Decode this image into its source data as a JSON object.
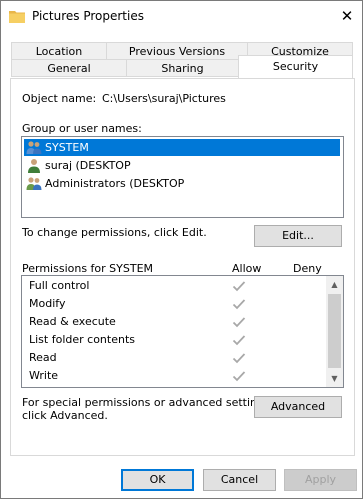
{
  "window": {
    "title": "Pictures Properties",
    "close_glyph": "✕"
  },
  "tabs": {
    "row_back": [
      "Location",
      "Previous Versions",
      "Customize"
    ],
    "row_front": [
      "General",
      "Sharing",
      "Security"
    ],
    "active": "Security"
  },
  "security": {
    "object_name_label": "Object name:",
    "object_name_value": "C:\\Users\\suraj\\Pictures",
    "group_label": "Group or user names:",
    "users": [
      {
        "name": "SYSTEM",
        "selected": true,
        "icon": "users-group-icon"
      },
      {
        "name": "suraj (DESKTOP",
        "selected": false,
        "icon": "user-icon"
      },
      {
        "name": "Administrators (DESKTOP",
        "selected": false,
        "icon": "users-group-icon"
      }
    ],
    "change_hint": "To change permissions, click Edit.",
    "edit_button": "Edit...",
    "permissions_for": "Permissions for SYSTEM",
    "allow_header": "Allow",
    "deny_header": "Deny",
    "permissions": [
      {
        "name": "Full control",
        "allow": true,
        "deny": false
      },
      {
        "name": "Modify",
        "allow": true,
        "deny": false
      },
      {
        "name": "Read & execute",
        "allow": true,
        "deny": false
      },
      {
        "name": "List folder contents",
        "allow": true,
        "deny": false
      },
      {
        "name": "Read",
        "allow": true,
        "deny": false
      },
      {
        "name": "Write",
        "allow": true,
        "deny": false
      }
    ],
    "special_hint_line1": "For special permissions or advanced settings,",
    "special_hint_line2": "click Advanced.",
    "advanced_button": "Advanced"
  },
  "footer": {
    "ok": "OK",
    "cancel": "Cancel",
    "apply": "Apply"
  },
  "colors": {
    "selection": "#0078d7",
    "check": "#a8a8a8"
  }
}
